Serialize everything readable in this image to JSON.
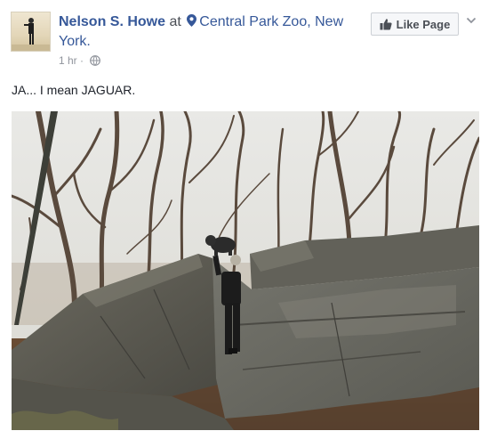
{
  "post": {
    "author_name": "Nelson S. Howe",
    "at_word": "at",
    "location": "Central Park Zoo, New York.",
    "timestamp": "1 hr",
    "meta_separator": "·",
    "message": "JA... I mean JAGUAR.",
    "like_page_label": "Like Page"
  },
  "icons": {
    "location": "map-pin-icon",
    "privacy": "globe-icon",
    "like": "thumbs-up-icon",
    "options": "chevron-down-icon"
  },
  "colors": {
    "link": "#365899",
    "text": "#1d2129",
    "meta": "#90949c",
    "button_bg": "#f6f7f9"
  }
}
